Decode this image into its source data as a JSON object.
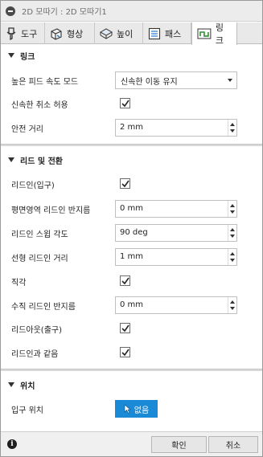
{
  "window": {
    "title": "2D 모따기 : 2D 모따기1"
  },
  "tabs": [
    {
      "label": "도구",
      "icon": "tool-icon"
    },
    {
      "label": "형상",
      "icon": "geometry-icon"
    },
    {
      "label": "높이",
      "icon": "heights-icon"
    },
    {
      "label": "패스",
      "icon": "passes-icon"
    },
    {
      "label": "링크",
      "icon": "linking-icon"
    }
  ],
  "link_section": {
    "title": "링크",
    "high_feed_mode_label": "높은 피드 속도 모드",
    "high_feed_mode_value": "신속한 이동 유지",
    "allow_rapid_retract_label": "신속한 취소 허용",
    "allow_rapid_retract_checked": true,
    "safe_distance_label": "안전 거리",
    "safe_distance_value": "2 mm"
  },
  "leads_section": {
    "title": "리드 및 전환",
    "lead_in_label": "리드인(입구)",
    "lead_in_checked": true,
    "horizontal_lead_in_radius_label": "평면영역 리드인 반지름",
    "horizontal_lead_in_radius_value": "0 mm",
    "lead_in_sweep_angle_label": "리드인 스윕 각도",
    "lead_in_sweep_angle_value": "90 deg",
    "linear_lead_in_distance_label": "선형 리드인 거리",
    "linear_lead_in_distance_value": "1 mm",
    "perpendicular_label": "직각",
    "perpendicular_checked": true,
    "vertical_lead_in_radius_label": "수직 리드인 반지름",
    "vertical_lead_in_radius_value": "0 mm",
    "lead_out_label": "리드아웃(출구)",
    "lead_out_checked": true,
    "same_as_lead_in_label": "리드인과 같음",
    "same_as_lead_in_checked": true
  },
  "positions_section": {
    "title": "위치",
    "entry_position_label": "입구 위치",
    "entry_position_button": "없음"
  },
  "footer": {
    "ok_label": "확인",
    "cancel_label": "취소"
  },
  "colors": {
    "accent": "#1b8ad6",
    "linking_tab_icon": "#2f8f2f"
  }
}
